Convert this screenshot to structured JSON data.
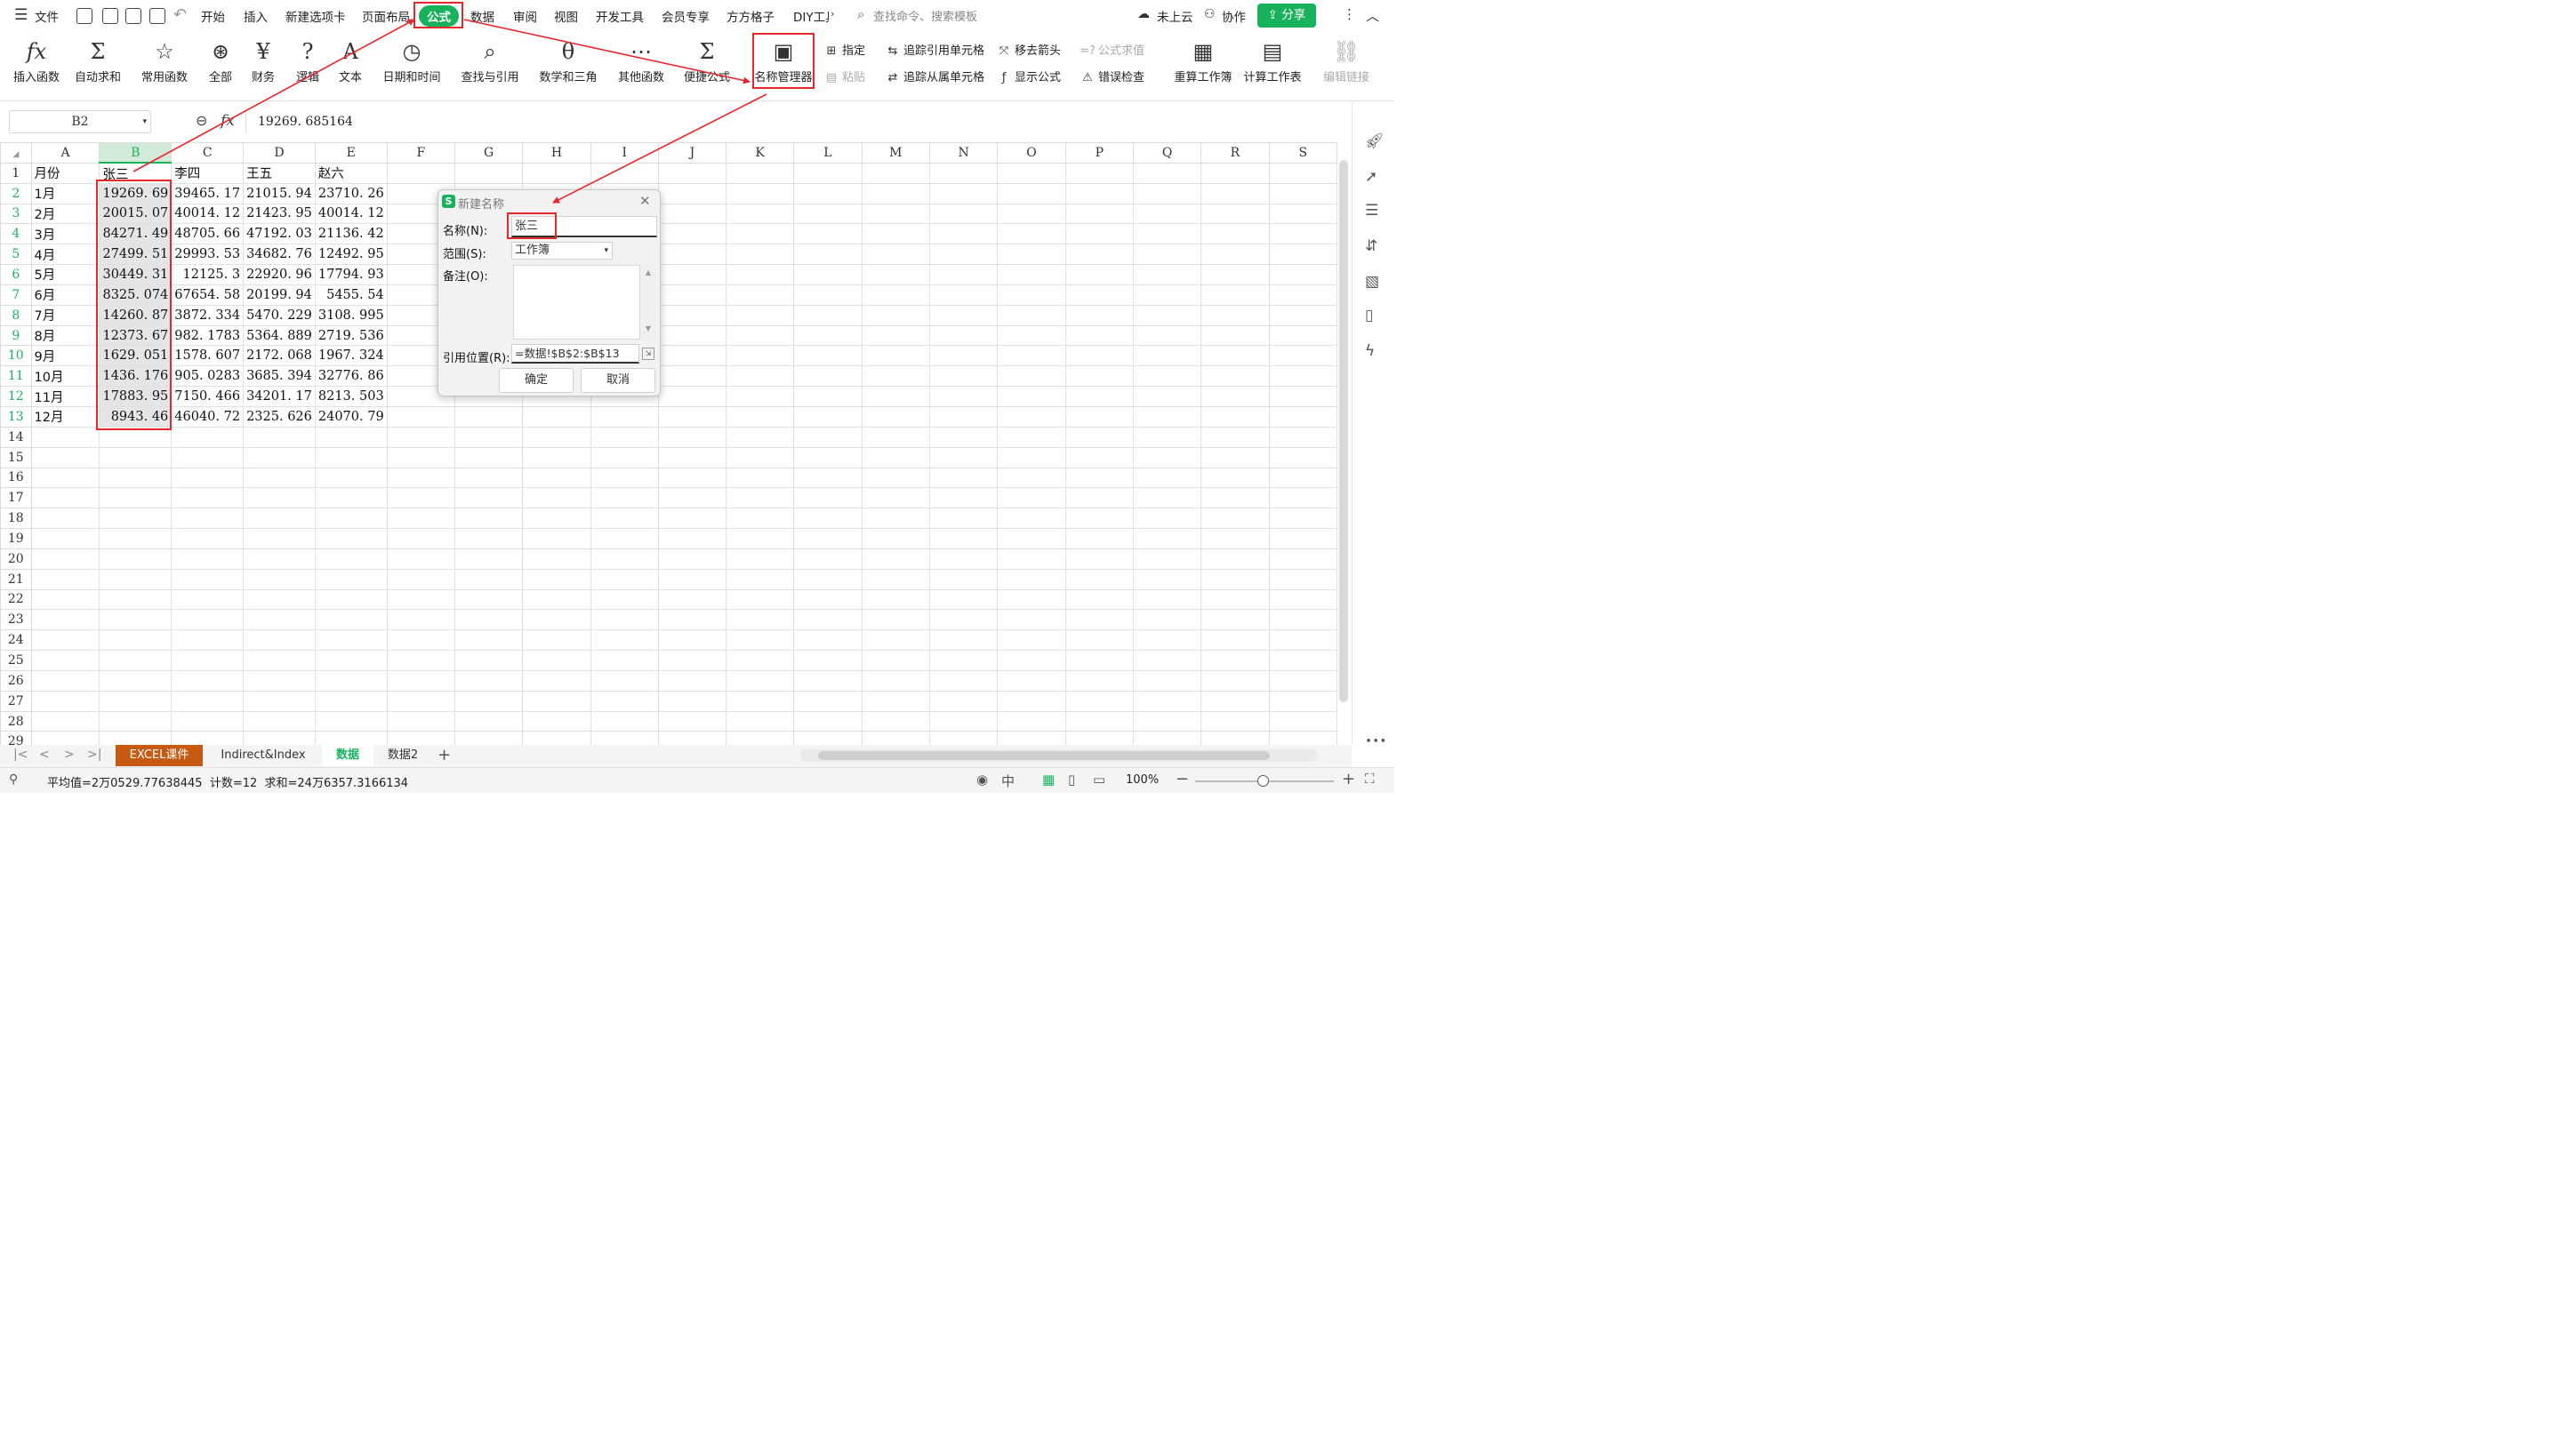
{
  "menu": {
    "file": "文件",
    "tabs": [
      "开始",
      "插入",
      "新建选项卡",
      "页面布局",
      "公式",
      "数据",
      "审阅",
      "视图",
      "开发工具",
      "会员专享",
      "方方格子",
      "DIY工具"
    ],
    "active": "公式",
    "search": "查找命令、搜索模板",
    "cloud": "未上云",
    "collab": "协作",
    "share": "分享"
  },
  "ribbon": {
    "insert_func": "插入函数",
    "autosum": "自动求和",
    "common": "常用函数",
    "all": "全部",
    "finance": "财务",
    "logic": "逻辑",
    "text": "文本",
    "datetime": "日期和时间",
    "lookup": "查找与引用",
    "math": "数学和三角",
    "other": "其他函数",
    "quick": "便捷公式",
    "name_manager": "名称管理器",
    "specify": "指定",
    "paste": "粘贴",
    "trace_prec": "追踪引用单元格",
    "trace_dep": "追踪从属单元格",
    "remove_arrows": "移去箭头",
    "show_formula": "显示公式",
    "eval": "公式求值",
    "error_check": "错误检查",
    "recalc_wb": "重算工作簿",
    "calc_sheet": "计算工作表",
    "edit_links": "编辑链接"
  },
  "formula_bar": {
    "cell_ref": "B2",
    "fx": "fx",
    "value": "19269. 685164"
  },
  "columns": [
    "A",
    "B",
    "C",
    "D",
    "E",
    "F",
    "G",
    "H",
    "I",
    "J",
    "K",
    "L",
    "M",
    "N",
    "O",
    "P",
    "Q",
    "R",
    "S"
  ],
  "rows": [
    [
      "月份",
      "张三",
      "李四",
      "王五",
      "赵六"
    ],
    [
      "1月",
      "19269. 69",
      "39465. 17",
      "21015. 94",
      "23710. 26"
    ],
    [
      "2月",
      "20015. 07",
      "40014. 12",
      "21423. 95",
      "40014. 12"
    ],
    [
      "3月",
      "84271. 49",
      "48705. 66",
      "47192. 03",
      "21136. 42"
    ],
    [
      "4月",
      "27499. 51",
      "29993. 53",
      "34682. 76",
      "12492. 95"
    ],
    [
      "5月",
      "30449. 31",
      "12125. 3",
      "22920. 96",
      "17794. 93"
    ],
    [
      "6月",
      "8325. 074",
      "67654. 58",
      "20199. 94",
      "5455. 54"
    ],
    [
      "7月",
      "14260. 87",
      "3872. 334",
      "5470. 229",
      "3108. 995"
    ],
    [
      "8月",
      "12373. 67",
      "982. 1783",
      "5364. 889",
      "2719. 536"
    ],
    [
      "9月",
      "1629. 051",
      "1578. 607",
      "2172. 068",
      "1967. 324"
    ],
    [
      "10月",
      "1436. 176",
      "905. 0283",
      "3685. 394",
      "32776. 86"
    ],
    [
      "11月",
      "17883. 95",
      "7150. 466",
      "34201. 17",
      "8213. 503"
    ],
    [
      "12月",
      "8943. 46",
      "46040. 72",
      "2325. 626",
      "24070. 79"
    ]
  ],
  "row_numbers": [
    "1",
    "2",
    "3",
    "4",
    "5",
    "6",
    "7",
    "8",
    "9",
    "10",
    "11",
    "12",
    "13",
    "14",
    "15",
    "16",
    "17",
    "18",
    "19",
    "20",
    "21",
    "22",
    "23",
    "24",
    "25",
    "26",
    "27",
    "28",
    "29"
  ],
  "dialog": {
    "title": "新建名称",
    "name_label": "名称(N):",
    "name_value": "张三",
    "scope_label": "范围(S):",
    "scope_value": "工作簿",
    "comment_label": "备注(O):",
    "ref_label": "引用位置(R):",
    "ref_value": "=数据!$B$2:$B$13",
    "ok": "确定",
    "cancel": "取消"
  },
  "sheet_tabs": [
    "EXCEL课件",
    "Indirect&Index",
    "数据",
    "数据2"
  ],
  "status": {
    "summary": "平均值=2万0529.77638445  计数=12  求和=24万6357.3166134",
    "zoom": "100%"
  },
  "colors": {
    "accent": "#19b25c",
    "annotation": "#e8272d"
  }
}
